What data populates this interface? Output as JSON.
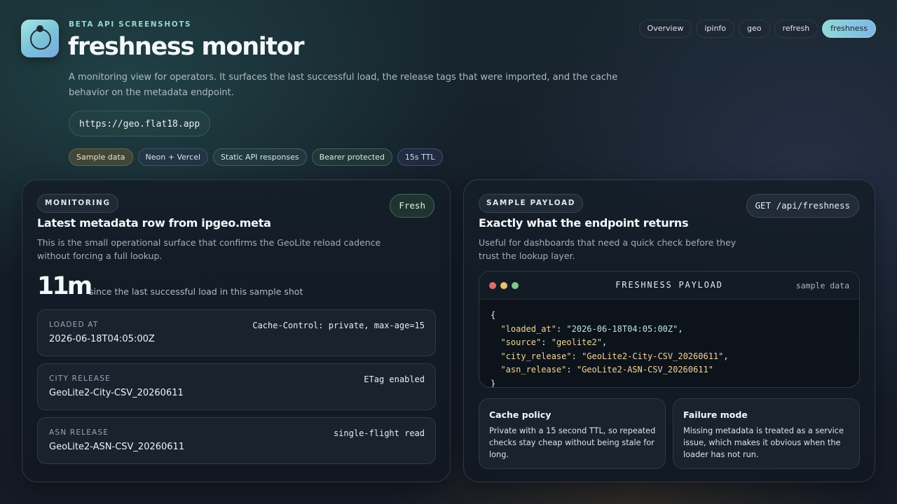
{
  "header": {
    "eyebrow": "BETA API SCREENSHOTS",
    "title": "freshness monitor",
    "description": "A monitoring view for operators. It surfaces the last successful load, the release tags that were imported, and the cache behavior on the metadata endpoint.",
    "url": "https://geo.flat18.app",
    "tags": [
      "Sample data",
      "Neon + Vercel",
      "Static API responses",
      "Bearer protected",
      "15s TTL"
    ]
  },
  "nav": {
    "items": [
      "Overview",
      "ipinfo",
      "geo",
      "refresh",
      "freshness"
    ],
    "active": "freshness"
  },
  "monitoring": {
    "eyebrow": "MONITORING",
    "status": "Fresh",
    "title": "Latest metadata row from ipgeo.meta",
    "description": "This is the small operational surface that confirms the GeoLite reload cadence without forcing a full lookup.",
    "age_value": "11m",
    "age_caption": "since the last successful load in this sample shot",
    "rows": [
      {
        "label": "LOADED AT",
        "value": "2026-06-18T04:05:00Z",
        "meta": "Cache-Control: private, max-age=15"
      },
      {
        "label": "CITY RELEASE",
        "value": "GeoLite2-City-CSV_20260611",
        "meta": "ETag enabled"
      },
      {
        "label": "ASN RELEASE",
        "value": "GeoLite2-ASN-CSV_20260611",
        "meta": "single-flight read"
      }
    ]
  },
  "payload": {
    "eyebrow": "SAMPLE PAYLOAD",
    "endpoint": "GET /api/freshness",
    "title": "Exactly what the endpoint returns",
    "description": "Useful for dashboards that need a quick check before they trust the lookup layer.",
    "code_title": "FRESHNESS PAYLOAD",
    "code_tag": "sample data",
    "code": {
      "loaded_at": "2026-06-18T04:05:00Z",
      "source": "geolite2",
      "city_release": "GeoLite2-City-CSV_20260611",
      "asn_release": "GeoLite2-ASN-CSV_20260611"
    },
    "cards": [
      {
        "title": "Cache policy",
        "body": "Private with a 15 second TTL, so repeated checks stay cheap without being stale for long."
      },
      {
        "title": "Failure mode",
        "body": "Missing metadata is treated as a service issue, which makes it obvious when the loader has not run."
      }
    ]
  },
  "colors": {
    "accent": "#8fd9d0",
    "dot_red": "#e06c6c",
    "dot_yellow": "#e8c170",
    "dot_green": "#7cc98c"
  }
}
